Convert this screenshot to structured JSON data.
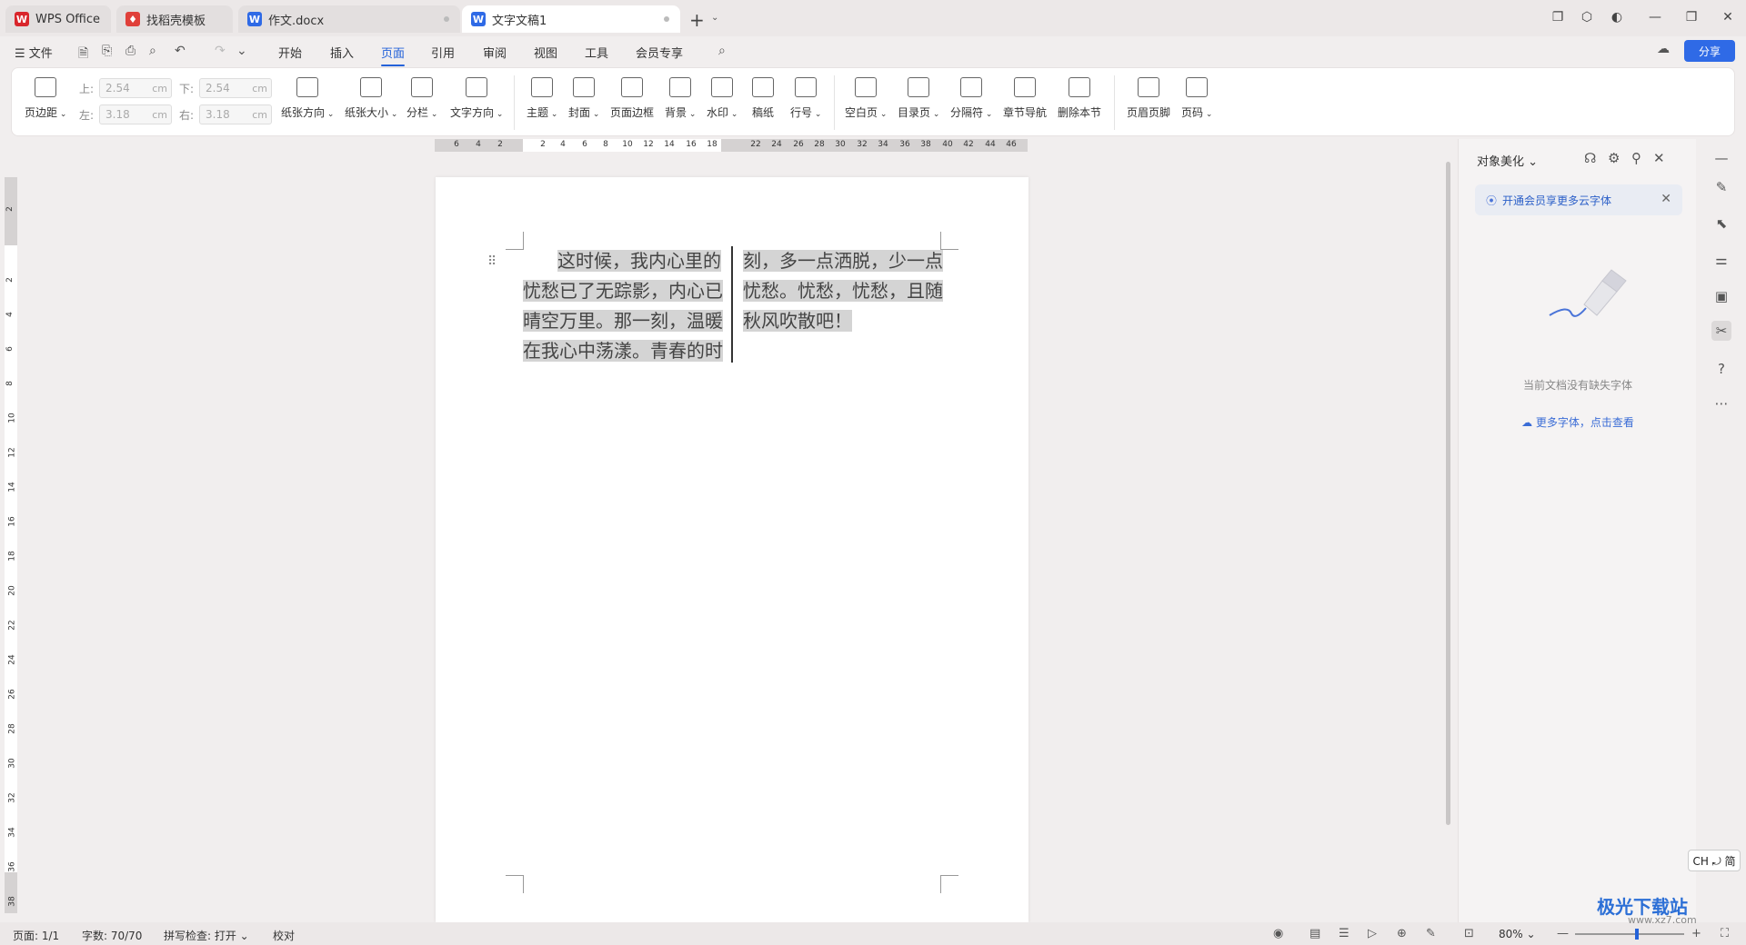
{
  "tabs": [
    {
      "label": "WPS Office",
      "color": "#d9262c"
    },
    {
      "label": "找稻壳模板",
      "color": "#e0403a"
    },
    {
      "label": "作文.docx",
      "color": "#2f6ae6"
    },
    {
      "label": "文字文稿1",
      "color": "#2f6ae6"
    }
  ],
  "menu": {
    "file": "文件",
    "items": [
      "开始",
      "插入",
      "页面",
      "引用",
      "审阅",
      "视图",
      "工具",
      "会员专享"
    ],
    "active": "页面",
    "share": "分享"
  },
  "ribbon": {
    "margin_label": "页边距",
    "top_label": "上:",
    "top_value": "2.54",
    "bottom_label": "下:",
    "bottom_value": "2.54",
    "left_label": "左:",
    "left_value": "3.18",
    "right_label": "右:",
    "right_value": "3.18",
    "unit": "cm",
    "buttons": [
      "纸张方向",
      "纸张大小",
      "分栏",
      "文字方向",
      "主题",
      "封面",
      "页面边框",
      "背景",
      "水印",
      "稿纸",
      "行号",
      "空白页",
      "目录页",
      "分隔符",
      "章节导航",
      "删除本节",
      "页眉页脚",
      "页码"
    ]
  },
  "ruler": {
    "h_ticks": [
      "6",
      "4",
      "2",
      "2",
      "4",
      "6",
      "8",
      "10",
      "12",
      "14",
      "16",
      "18",
      "22",
      "24",
      "26",
      "28",
      "30",
      "32",
      "34",
      "36",
      "38",
      "40",
      "42",
      "44",
      "46"
    ],
    "v_ticks": [
      "2",
      "2",
      "4",
      "6",
      "8",
      "10",
      "12",
      "14",
      "16",
      "18",
      "20",
      "22",
      "24",
      "26",
      "28",
      "30",
      "32",
      "34",
      "36",
      "38"
    ]
  },
  "document": {
    "left_column": [
      "这时候，我内心里的",
      "忧愁已了无踪影，内心已",
      "晴空万里。那一刻，温暖",
      "在我心中荡漾。青春的时"
    ],
    "right_column": [
      "刻，多一点洒脱，少一点",
      "忧愁。忧愁，忧愁，且随",
      "秋风吹散吧！"
    ]
  },
  "panel": {
    "title": "对象美化",
    "promo": "开通会员享更多云字体",
    "empty": "当前文档没有缺失字体",
    "more": "更多字体，点击查看"
  },
  "ime": "CH ⤾ 简",
  "status": {
    "page": "页面: 1/1",
    "words": "字数: 70/70",
    "spell": "拼写检查: 打开",
    "proof": "校对",
    "zoom": "80%"
  },
  "watermark": {
    "main": "极光下载站",
    "sub": "www.xz7.com"
  },
  "colors": {
    "accent": "#2462d9",
    "share": "#2f6ae6"
  }
}
